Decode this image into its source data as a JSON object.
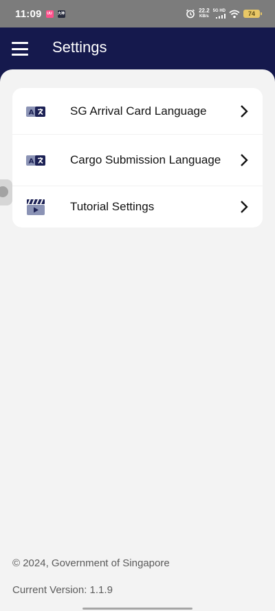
{
  "status_bar": {
    "time": "11:09",
    "app_icon_1": "UU",
    "app_icon_2": "大神",
    "net_speed_value": "22.2",
    "net_speed_unit": "KB/s",
    "network_label": "5G HD",
    "battery": "74"
  },
  "header": {
    "title": "Settings",
    "menu_icon": "hamburger-menu-icon"
  },
  "settings_items": [
    {
      "label": "SG Arrival Card Language",
      "icon": "language-translate-icon"
    },
    {
      "label": "Cargo Submission Language",
      "icon": "language-translate-icon"
    },
    {
      "label": "Tutorial Settings",
      "icon": "video-clapper-icon"
    }
  ],
  "footer": {
    "copyright": "© 2024, Government of Singapore",
    "version": "Current Version: 1.1.9"
  },
  "colors": {
    "app_bar": "#15194d",
    "background": "#f3f3f3",
    "card": "#ffffff",
    "icon_dark": "#1c2155",
    "icon_light": "#8b93b5"
  }
}
